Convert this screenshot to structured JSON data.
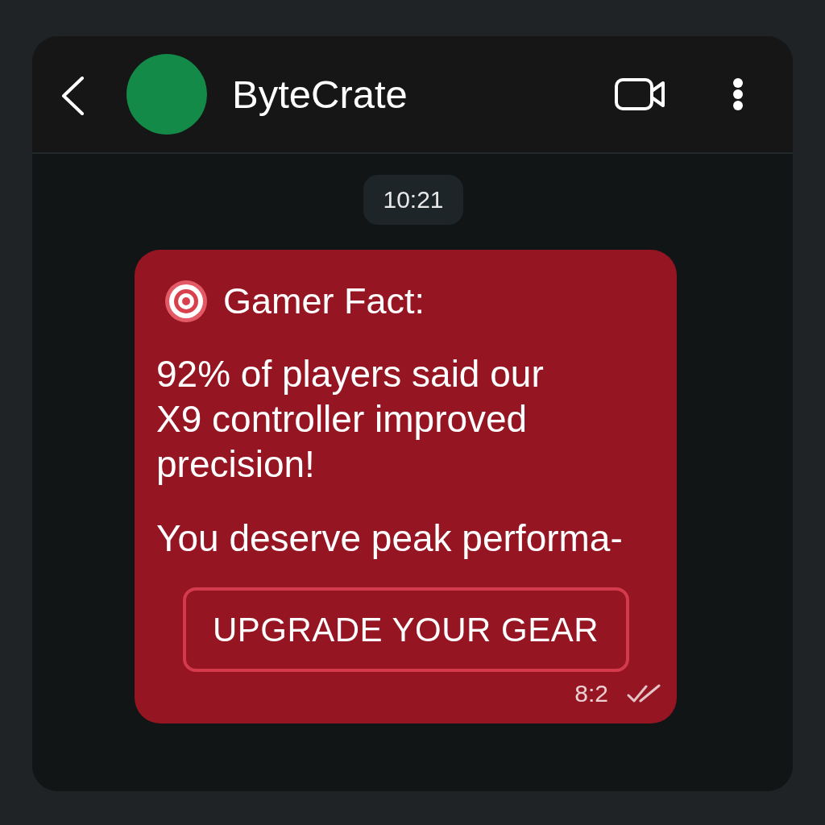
{
  "header": {
    "title": "ByteCrate"
  },
  "date_chip": "10:21",
  "message": {
    "title": "Gamer Fact:",
    "paragraphs": [
      "92% of players said our X9 controller improved precision!",
      "You deserve peak performa-"
    ],
    "button": "UPGRADE YOUR GEAR",
    "time": "8:2"
  }
}
